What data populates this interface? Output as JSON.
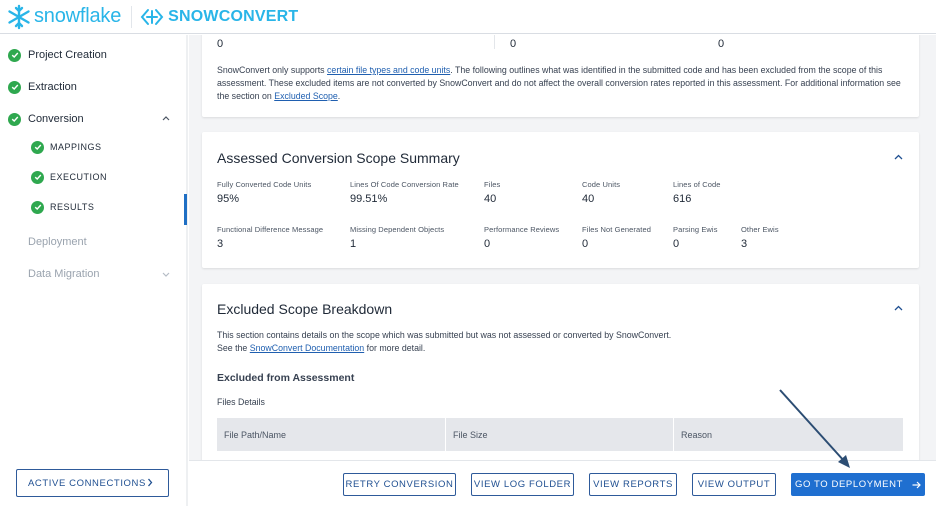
{
  "header": {
    "snowflake_logo_text": "snowflake",
    "snowconvert_logo_text": "SNOWCONVERT",
    "brand_color": "#29b5e8"
  },
  "sidebar": {
    "items": [
      {
        "label": "Project Creation",
        "status": "complete"
      },
      {
        "label": "Extraction",
        "status": "complete"
      },
      {
        "label": "Conversion",
        "status": "complete",
        "expanded": true,
        "children": [
          {
            "label": "MAPPINGS",
            "status": "complete"
          },
          {
            "label": "EXECUTION",
            "status": "complete"
          },
          {
            "label": "RESULTS",
            "status": "complete",
            "active": true
          }
        ]
      },
      {
        "label": "Deployment",
        "status": "disabled"
      },
      {
        "label": "Data Migration",
        "status": "disabled"
      }
    ],
    "active_connections_label": "ACTIVE CONNECTIONS"
  },
  "top_section": {
    "values": [
      "0",
      "0",
      "0"
    ],
    "notice_before_link1": "SnowConvert only supports ",
    "notice_link1": "certain file types and code units",
    "notice_after_link1": ". The following outlines what was identified in the submitted code and has been excluded from the scope of this assessment. These excluded items are not converted by SnowConvert and do not affect the overall conversion rates reported in this assessment. For additional information see the section on ",
    "notice_link2": "Excluded Scope",
    "notice_end": "."
  },
  "assessed_summary": {
    "title": "Assessed Conversion Scope Summary",
    "row1": [
      {
        "label": "Fully Converted Code Units",
        "value": "95%"
      },
      {
        "label": "Lines Of Code Conversion Rate",
        "value": "99.51%"
      },
      {
        "label": "Files",
        "value": "40"
      },
      {
        "label": "Code Units",
        "value": "40"
      },
      {
        "label": "Lines of Code",
        "value": "616"
      }
    ],
    "row2": [
      {
        "label": "Functional Difference Message",
        "value": "3"
      },
      {
        "label": "Missing Dependent Objects",
        "value": "1"
      },
      {
        "label": "Performance Reviews",
        "value": "0"
      },
      {
        "label": "Files Not Generated",
        "value": "0"
      },
      {
        "label": "Parsing Ewis",
        "value": "0"
      },
      {
        "label": "Other Ewis",
        "value": "3"
      }
    ]
  },
  "excluded_breakdown": {
    "title": "Excluded Scope Breakdown",
    "desc_line1": "This section contains details on the scope which was submitted but was not assessed or converted by SnowConvert.",
    "desc_line2_before": "See the ",
    "desc_line2_link": "SnowConvert Documentation",
    "desc_line2_after": " for more detail.",
    "subheading": "Excluded from Assessment",
    "files_details_label": "Files Details",
    "columns": [
      "File Path/Name",
      "File Size",
      "Reason"
    ]
  },
  "footer": {
    "retry_label": "RETRY CONVERSION",
    "view_log_label": "VIEW LOG FOLDER",
    "view_reports_label": "VIEW REPORTS",
    "view_output_label": "VIEW OUTPUT",
    "go_to_deployment_label": "GO TO DEPLOYMENT"
  },
  "colors": {
    "success": "#2fa84f",
    "primary": "#1f6fd0",
    "link": "#1f5fb0"
  }
}
